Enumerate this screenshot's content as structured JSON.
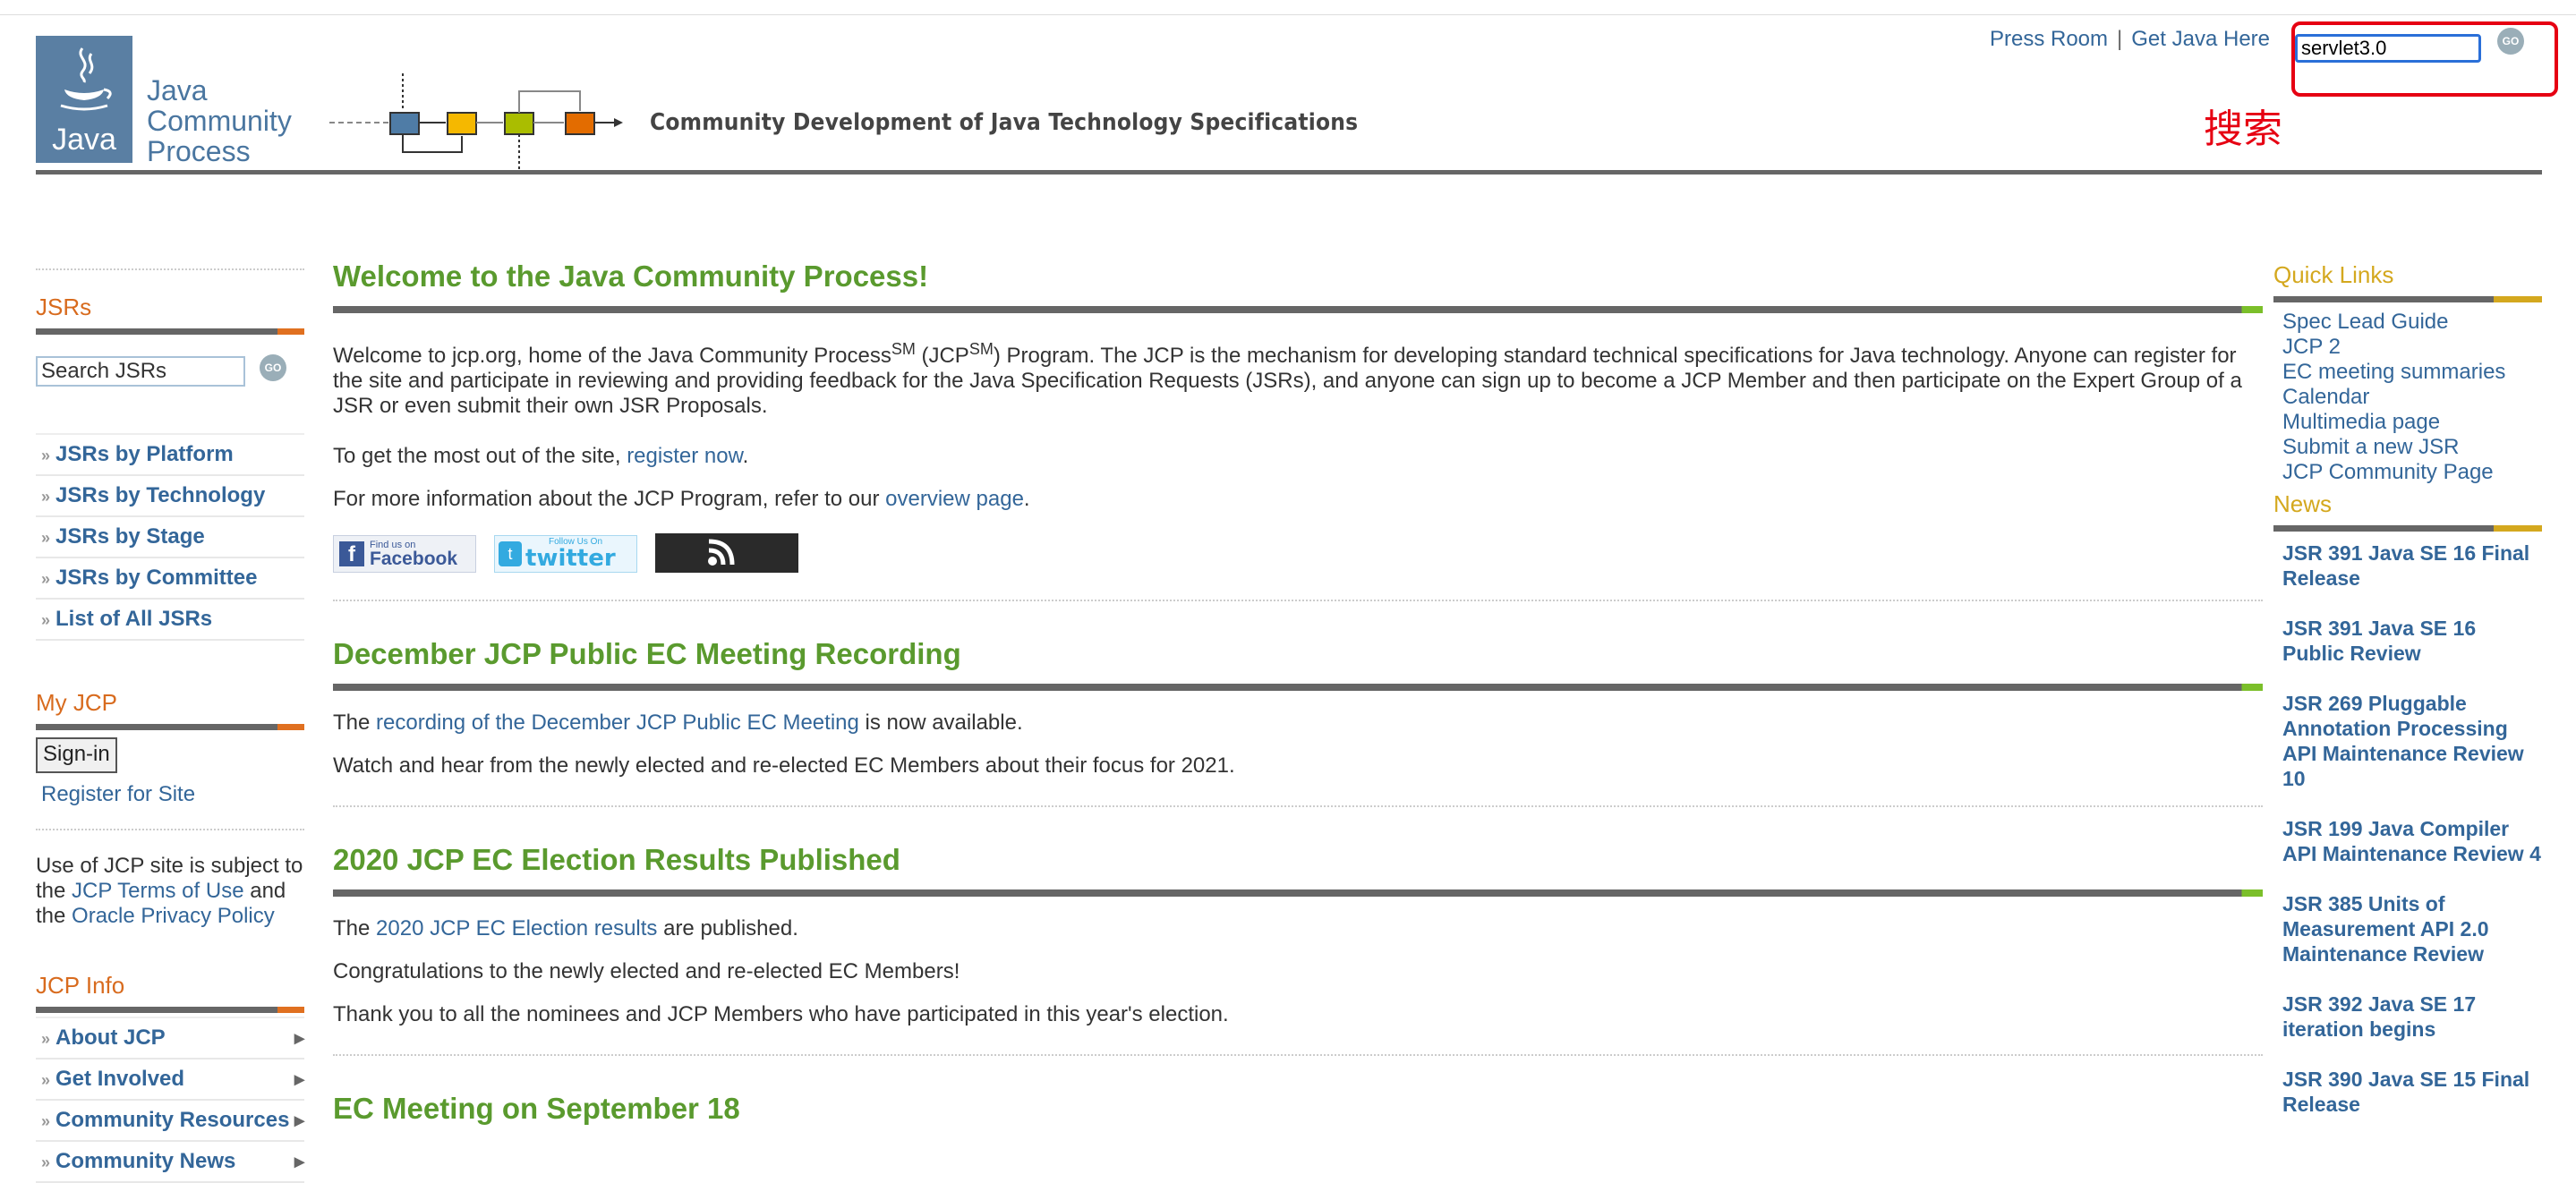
{
  "header": {
    "logo_word": "Java",
    "logo_text": [
      "Java",
      "Community",
      "Process"
    ],
    "tagline": "Community Development of Java Technology Specifications",
    "links": [
      "Press Room",
      "Get Java Here"
    ],
    "search_value": "servlet3.0",
    "go_label": "GO",
    "annotation_label": "搜索"
  },
  "left": {
    "jsrs_title": "JSRs",
    "search_placeholder": "Search JSRs",
    "go_label": "GO",
    "jsr_links": [
      "JSRs by Platform",
      "JSRs by Technology",
      "JSRs by Stage",
      "JSRs by Committee",
      "List of All JSRs"
    ],
    "myjcp_title": "My JCP",
    "signin_label": "Sign-in",
    "register_label": "Register for Site",
    "terms": {
      "t1": "Use of JCP site is subject to the ",
      "link1": "JCP Terms of Use",
      "t2": " and the ",
      "link2": "Oracle Privacy Policy"
    },
    "info_title": "JCP Info",
    "info_links": [
      "About JCP",
      "Get Involved",
      "Community Resources",
      "Community News"
    ]
  },
  "main": {
    "welcome_title": "Welcome to the Java Community Process!",
    "welcome_p1_a": "Welcome to jcp.org, home of the Java Community Process",
    "sm": "SM",
    "welcome_p1_b": " (JCP",
    "welcome_p1_c": ") Program. The JCP is the mechanism for developing standard technical specifications for Java technology. Anyone can register for the site and participate in reviewing and providing feedback for the Java Specification Requests (JSRs), and anyone can sign up to become a JCP Member and then participate on the Expert Group of a JSR or even submit their own JSR Proposals.",
    "welcome_p2_a": "To get the most out of the site, ",
    "welcome_p2_link": "register now",
    "welcome_p2_b": ".",
    "welcome_p3_a": "For more information about the JCP Program, refer to our ",
    "welcome_p3_link": "overview page",
    "welcome_p3_b": ".",
    "social": {
      "fb_small": "Find us on",
      "fb_big": "Facebook",
      "tw_small": "Follow Us On",
      "tw_big": "twitter"
    },
    "sec2_title": "December JCP Public EC Meeting Recording",
    "sec2_p1_a": "The ",
    "sec2_p1_link": "recording of the December JCP Public EC Meeting",
    "sec2_p1_b": " is now available.",
    "sec2_p2": "Watch and hear from the newly elected and re-elected EC Members about their focus for 2021.",
    "sec3_title": "2020 JCP EC Election Results Published",
    "sec3_p1_a": "The ",
    "sec3_p1_link": "2020 JCP EC Election results",
    "sec3_p1_b": " are published.",
    "sec3_p2": "Congratulations to the newly elected and re-elected EC Members!",
    "sec3_p3": "Thank you to all the nominees and JCP Members who have participated in this year's election.",
    "sec4_title": "EC Meeting on September 18"
  },
  "right": {
    "quick_title": "Quick Links",
    "quick_links": [
      "Spec Lead Guide",
      "JCP 2",
      "EC meeting summaries",
      "Calendar",
      "Multimedia page",
      "Submit a new JSR",
      "JCP Community Page"
    ],
    "news_title": "News",
    "news": [
      "JSR 391 Java SE 16 Final Release",
      "JSR 391 Java SE 16 Public Review",
      "JSR 269 Pluggable Annotation Processing API Maintenance Review 10",
      "JSR 199 Java Compiler API Maintenance Review 4",
      "JSR 385 Units of Measurement API 2.0 Maintenance Review",
      "JSR 392 Java SE 17 iteration begins",
      "JSR 390 Java SE 15 Final Release"
    ]
  },
  "colors": {
    "link": "#336699",
    "heading_green": "#5a9a2e",
    "sidebar_orange": "#d86b1e",
    "right_gold": "#d4a81e",
    "annotation_red": "#e60012"
  }
}
